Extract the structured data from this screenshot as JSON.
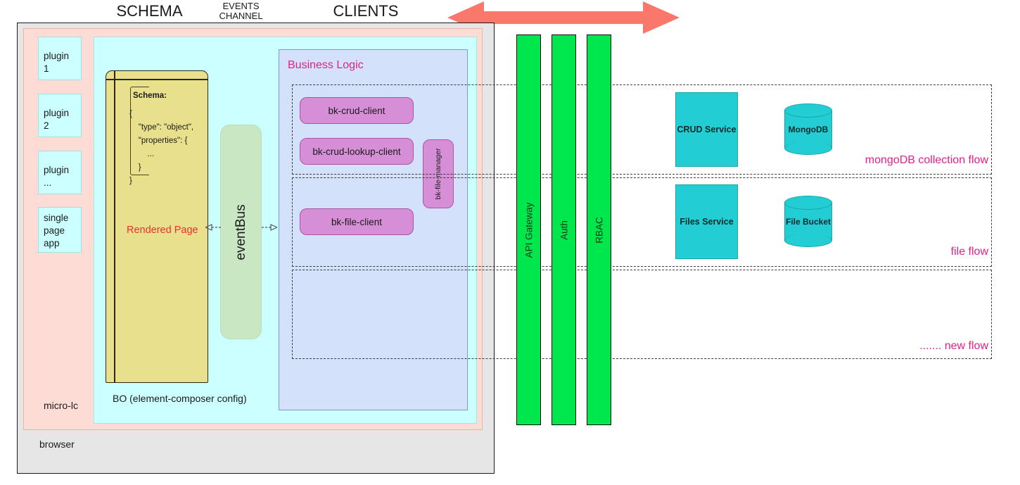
{
  "headers": {
    "schema": "SCHEMA",
    "events_channel_line1": "EVENTS",
    "events_channel_line2": "CHANNEL",
    "clients": "CLIENTS"
  },
  "colors": {
    "browser_bg": "#e6e6e6",
    "microlc_bg": "#fcdcd4",
    "bo_bg": "#ccffff",
    "schema_card": "#e8e08c",
    "eventbus": "#c9e7c2",
    "business_logic_bg": "#d4e1fb",
    "client_pill": "#d68fd6",
    "gateway_green": "#00e64d",
    "service_cyan": "#22cdd4",
    "flow_label_pink": "#e0218a",
    "rendered_page_red": "#e8312f",
    "top_arrow": "#f9776b"
  },
  "browser": {
    "label": "browser"
  },
  "microlc": {
    "label": "micro-lc",
    "plugins": [
      {
        "label": "plugin 1"
      },
      {
        "label": "plugin 2"
      },
      {
        "label": "plugin ..."
      },
      {
        "label": "single\npage\napp"
      }
    ]
  },
  "bo": {
    "caption": "BO (element-composer config)",
    "schema_card": {
      "heading": "Schema:",
      "body": "{\n    \"type\": \"object\",\n    \"properties\": {\n        ...\n    }\n}",
      "rendered_page": "Rendered Page"
    },
    "eventbus": {
      "label": "eventBus"
    },
    "business_logic": {
      "title": "Business Logic",
      "clients": [
        {
          "label": "bk-crud-client"
        },
        {
          "label": "bk-crud-lookup-client"
        },
        {
          "label": "bk-file-client"
        }
      ],
      "file_manager": {
        "label": "bk-file-manager"
      }
    }
  },
  "gateway_bars": [
    {
      "label": "API Gateway"
    },
    {
      "label": "Auth"
    },
    {
      "label": "RBAC"
    }
  ],
  "flows": [
    {
      "name": "mongodb-collection-flow",
      "label": "mongoDB collection flow",
      "service": "CRUD Service",
      "database": "MongoDB"
    },
    {
      "name": "file-flow",
      "label": "file flow",
      "service": "Files Service",
      "database": "File Bucket"
    },
    {
      "name": "new-flow",
      "label": "....... new flow",
      "service": "",
      "database": ""
    }
  ],
  "top_arrow": {
    "name": "bidirectional-arrow"
  }
}
